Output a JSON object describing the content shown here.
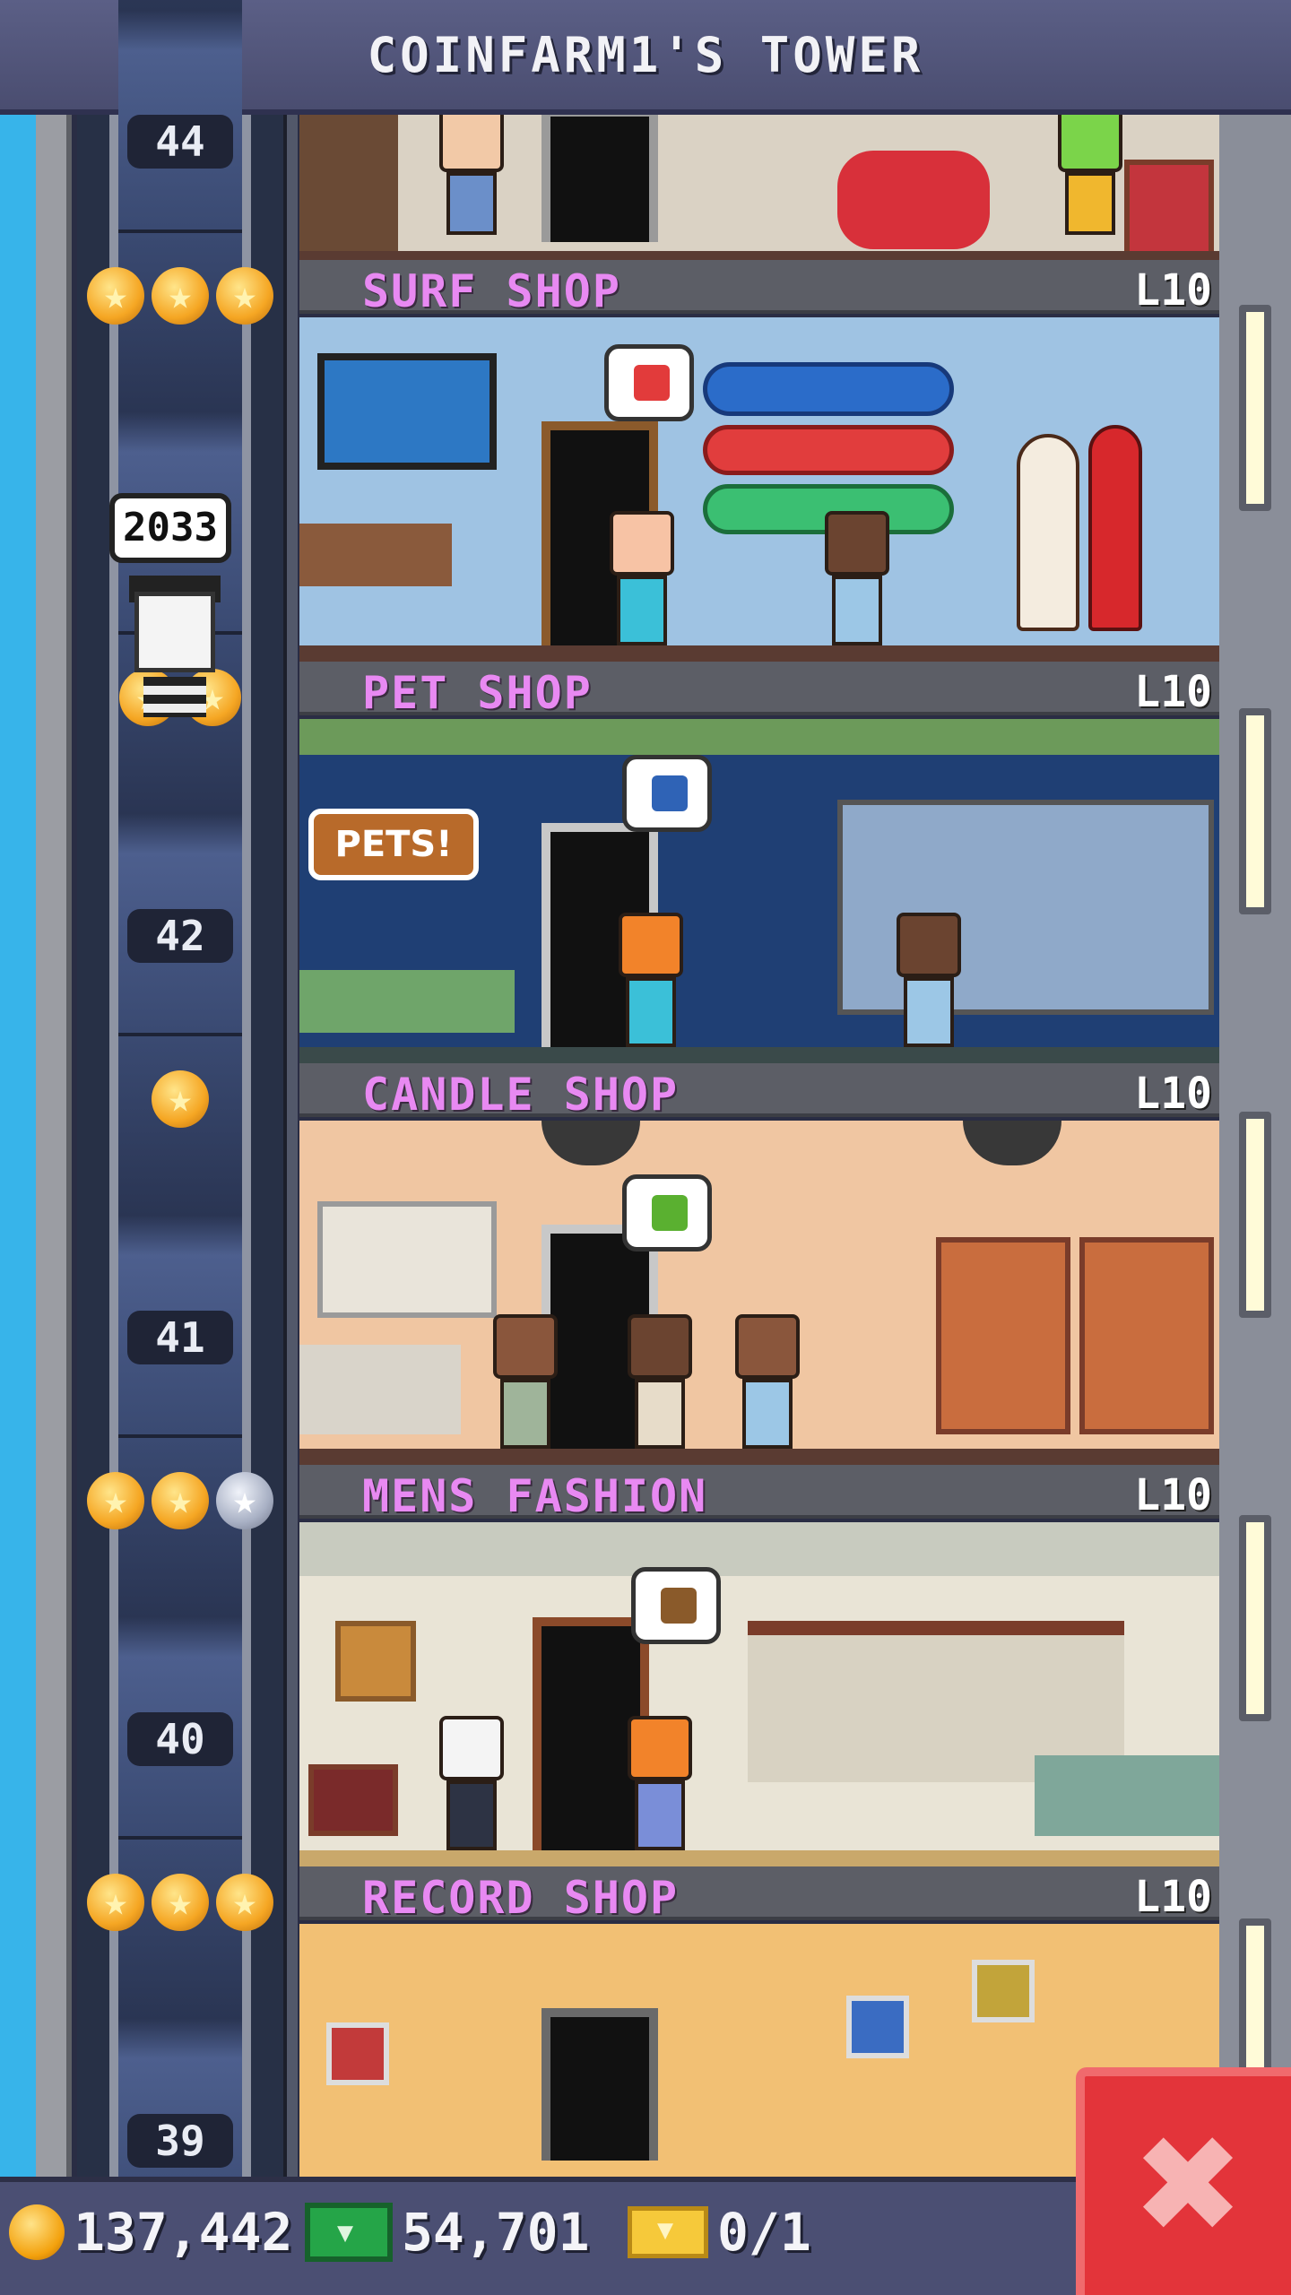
{
  "header": {
    "title": "COINFARM1'S TOWER"
  },
  "elevator": {
    "passenger_count": "2033"
  },
  "shaft_floors": [
    {
      "number": "44"
    },
    {
      "number": "42"
    },
    {
      "number": "41"
    },
    {
      "number": "40"
    },
    {
      "number": "39"
    }
  ],
  "floors": [
    {
      "name": "SURF SHOP",
      "level": "L10",
      "stars": 3,
      "silver_stars": 0,
      "wall_color": "#9fc3e3"
    },
    {
      "name": "PET SHOP",
      "level": "L10",
      "stars": 2,
      "silver_stars": 0,
      "wall_color": "#1f3f74"
    },
    {
      "name": "CANDLE SHOP",
      "level": "L10",
      "stars": 1,
      "silver_stars": 0,
      "wall_color": "#f0c6a2"
    },
    {
      "name": "MENS FASHION",
      "level": "L10",
      "stars": 2,
      "silver_stars": 1,
      "wall_color": "#e9e4d6"
    },
    {
      "name": "RECORD SHOP",
      "level": "L10",
      "stars": 3,
      "silver_stars": 0,
      "wall_color": "#f2c074"
    }
  ],
  "resources": {
    "coins": "137,442",
    "tower_bux": "54,701",
    "tickets": "0/1"
  },
  "icons": {
    "coin": "coin-icon",
    "bux": "bux-icon",
    "ticket": "golden-ticket-icon",
    "close": "close-icon"
  },
  "colors": {
    "floor_name": "#e889f2",
    "close_button": "#e3343a",
    "sky": "#37b4ea"
  }
}
